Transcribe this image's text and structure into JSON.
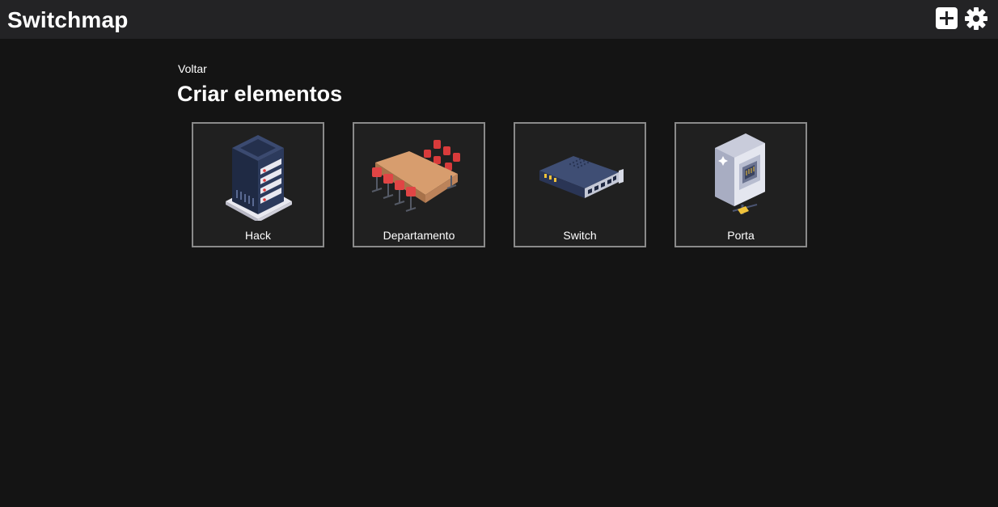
{
  "header": {
    "app_title": "Switchmap",
    "add_icon": "plus-square-icon",
    "settings_icon": "gear-icon"
  },
  "main": {
    "back_label": "Voltar",
    "title": "Criar elementos",
    "cards": [
      {
        "label": "Hack",
        "icon": "server-rack-icon"
      },
      {
        "label": "Departamento",
        "icon": "meeting-table-icon"
      },
      {
        "label": "Switch",
        "icon": "network-switch-icon"
      },
      {
        "label": "Porta",
        "icon": "ethernet-port-icon"
      }
    ]
  },
  "colors": {
    "background": "#141414",
    "topbar": "#232325",
    "card_border": "#8a8a8a",
    "card_background": "#202020"
  }
}
